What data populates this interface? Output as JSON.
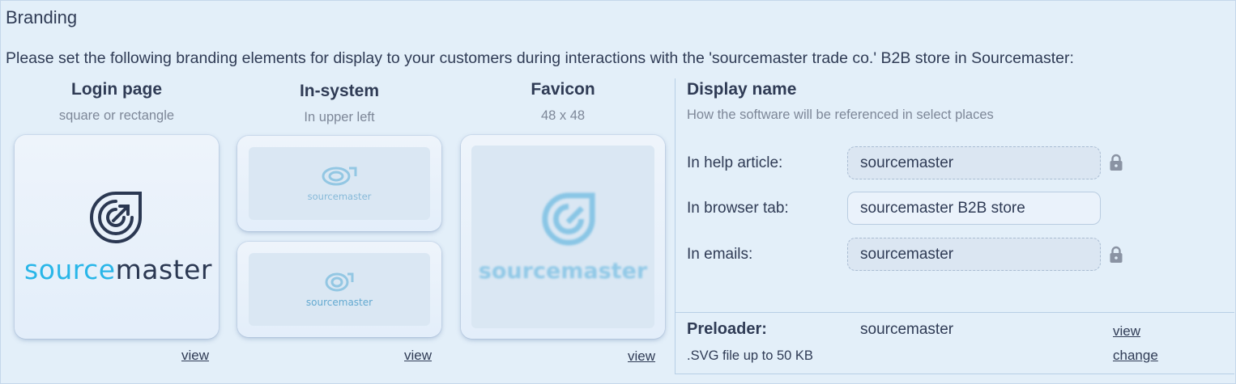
{
  "section": {
    "title": "Branding",
    "intro": "Please set the following branding elements for display to your customers during interactions with the 'sourcemaster trade co.' B2B store in Sourcemaster:"
  },
  "logos": {
    "login": {
      "heading": "Login page",
      "subheading": "square or rectangle",
      "view_label": "view",
      "wordmark_left": "source",
      "wordmark_right": "master"
    },
    "insystem": {
      "heading": "In-system",
      "subheading": "In upper left",
      "view_label": "view",
      "wordmark": "sourcemaster"
    },
    "favicon": {
      "heading": "Favicon",
      "subheading": "48 x 48",
      "view_label": "view",
      "wordmark": "sourcemaster"
    }
  },
  "display_name": {
    "title": "Display name",
    "subtitle": "How the software will be referenced in select places",
    "rows": [
      {
        "label": "In help article:",
        "value": "sourcemaster",
        "locked": true
      },
      {
        "label": "In browser tab:",
        "value": "sourcemaster B2B store",
        "locked": false
      },
      {
        "label": "In emails:",
        "value": "sourcemaster",
        "locked": true
      }
    ]
  },
  "preloader": {
    "label": "Preloader:",
    "value": "sourcemaster",
    "note": ".SVG file up to 50 KB",
    "view_label": "view",
    "change_label": "change"
  },
  "colors": {
    "background": "#e3eff9",
    "text": "#2f3b55",
    "muted": "#7d8798",
    "brand_blue": "#29b6e8",
    "brand_navy": "#2b3852"
  },
  "icons": [
    "lock-icon",
    "sourcemaster-logo-icon"
  ]
}
